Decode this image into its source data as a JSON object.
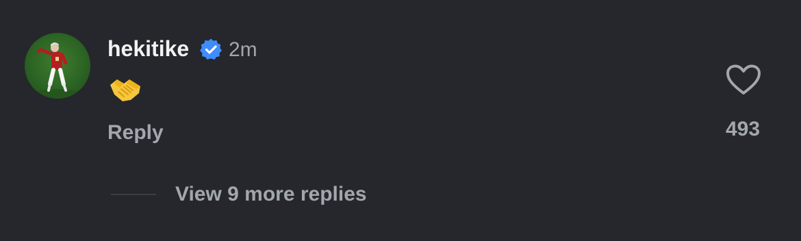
{
  "comment": {
    "username": "hekitike",
    "verified_icon": "verified-badge-icon",
    "timestamp": "2m",
    "emoji": "handshake-emoji",
    "reply_label": "Reply"
  },
  "like": {
    "icon": "heart-outline-icon",
    "count": "493"
  },
  "replies": {
    "view_more_label": "View 9 more replies"
  },
  "colors": {
    "background": "#25272c",
    "username": "#f2f2f3",
    "secondary_text": "#a2a6ad",
    "verified_blue": "#3f8dfd"
  }
}
